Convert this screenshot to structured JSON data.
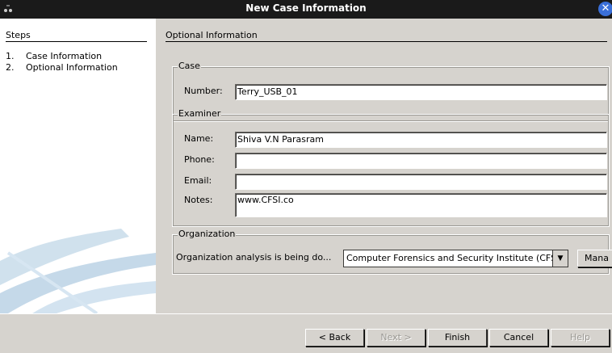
{
  "window": {
    "title": "New Case Information",
    "close_icon": "close-icon"
  },
  "steps": {
    "heading": "Steps",
    "items": [
      {
        "num": "1.",
        "label": "Case Information"
      },
      {
        "num": "2.",
        "label": "Optional Information"
      }
    ]
  },
  "main": {
    "heading": "Optional Information",
    "case": {
      "legend": "Case",
      "number_label": "Number:",
      "number_value": "Terry_USB_01"
    },
    "examiner": {
      "legend": "Examiner",
      "name_label": "Name:",
      "name_value": "Shiva V.N Parasram",
      "phone_label": "Phone:",
      "phone_value": "",
      "email_label": "Email:",
      "email_value": "",
      "notes_label": "Notes:",
      "notes_value": "www.CFSI.co"
    },
    "organization": {
      "legend": "Organization",
      "label": "Organization analysis is being do...",
      "selected": "Computer Forensics and Security Institute (CFSI)",
      "manage_label": "Mana"
    }
  },
  "footer": {
    "back": "< Back",
    "next": "Next >",
    "finish": "Finish",
    "cancel": "Cancel",
    "help": "Help"
  },
  "colors": {
    "titlebar": "#1a1a1a",
    "panel": "#d6d3ce",
    "close_button": "#3a6fd8"
  }
}
